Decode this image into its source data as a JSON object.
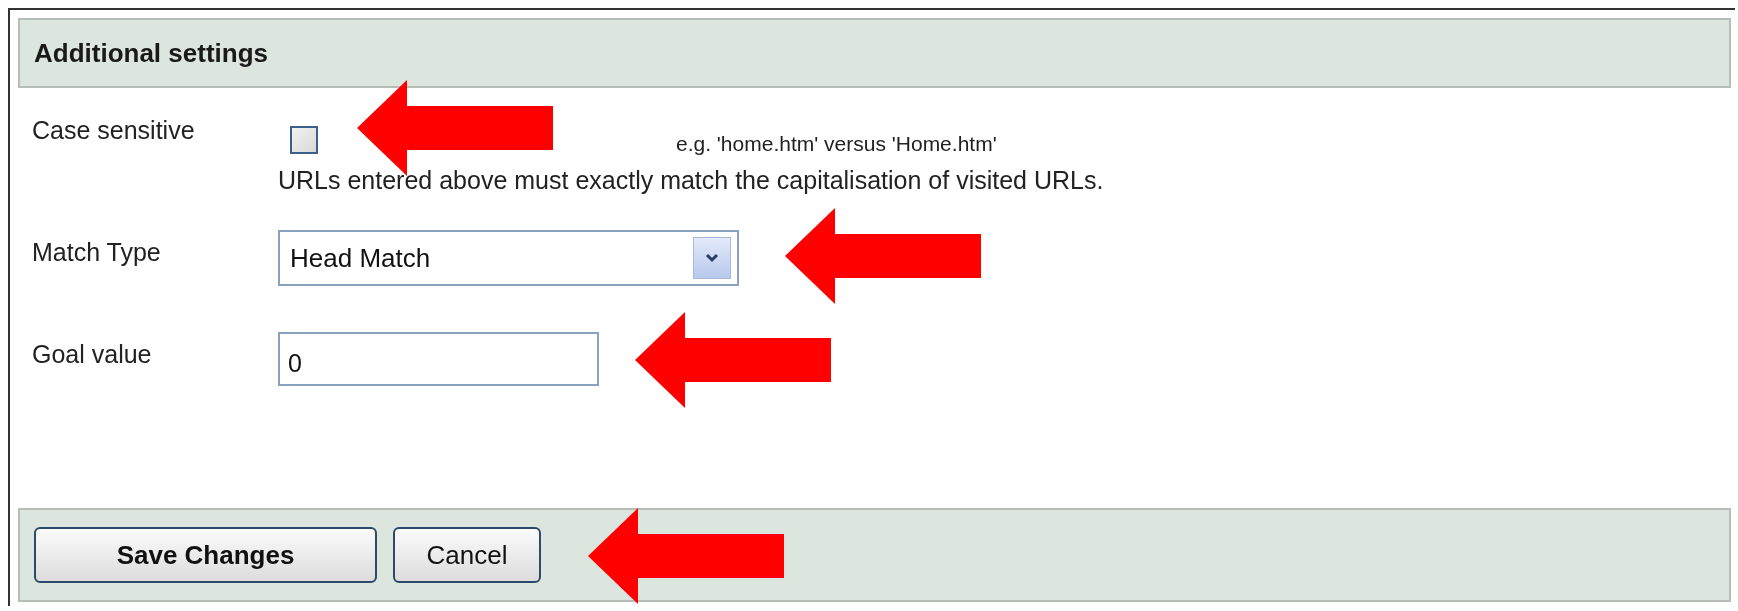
{
  "section": {
    "title": "Additional settings"
  },
  "case_sensitive": {
    "label": "Case sensitive",
    "checked": false,
    "arrow": true,
    "example": "e.g. 'home.htm' versus 'Home.htm'",
    "help": "URLs entered above must exactly match the capitalisation of visited URLs."
  },
  "match_type": {
    "label": "Match Type",
    "value": "Head Match",
    "arrow": true
  },
  "goal_value": {
    "label": "Goal value",
    "value": "0",
    "arrow": true
  },
  "footer": {
    "arrow": true,
    "buttons": [
      {
        "label": "Save Changes",
        "kind": "primary"
      },
      {
        "label": "Cancel",
        "kind": "secondary"
      }
    ]
  }
}
